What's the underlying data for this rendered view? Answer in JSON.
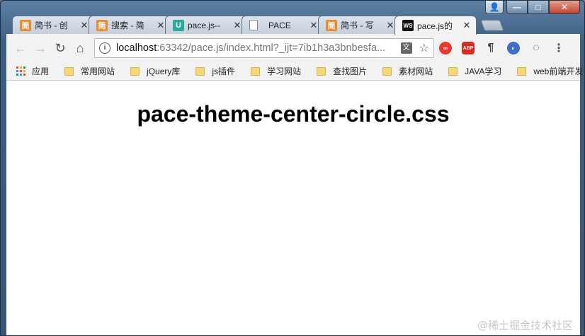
{
  "tabs": [
    {
      "title": "简书 - 创",
      "favicon": "简",
      "favicon_color": "#e98c30",
      "active": false
    },
    {
      "title": "搜索 - 简",
      "favicon": "简",
      "favicon_color": "#e98c30",
      "active": false
    },
    {
      "title": "pace.js--",
      "favicon": "U",
      "favicon_color": "#2aa89b",
      "active": false
    },
    {
      "title": "PACE",
      "favicon": "page-icon",
      "favicon_color": "#ffffff",
      "active": false
    },
    {
      "title": "简书 - 写",
      "favicon": "简",
      "favicon_color": "#e98c30",
      "active": false
    },
    {
      "title": "pace.js的",
      "favicon": "WS",
      "favicon_color": "#111111",
      "active": true
    }
  ],
  "toolbar": {
    "url_host": "localhost",
    "url_rest": ":63342/pace.js/index.html?_ijt=7ib1h3a3bnbesfa...",
    "info_glyph": "i"
  },
  "extensions": [
    "infinity-icon",
    "abp-icon",
    "pilcrow-icon",
    "proxy-icon",
    "refresh-circle-icon",
    "menu-icon"
  ],
  "bookmarks": {
    "apps_label": "应用",
    "items": [
      "常用网站",
      "jQuery库",
      "js插件",
      "学习网站",
      "查找图片",
      "素材网站",
      "JAVA学习",
      "web前端开发"
    ],
    "more": "»"
  },
  "page": {
    "heading": "pace-theme-center-circle.css"
  },
  "watermark": "@稀土掘金技术社区",
  "colors": {
    "abp": "#d42b20",
    "infinity": "#e53a2b"
  }
}
